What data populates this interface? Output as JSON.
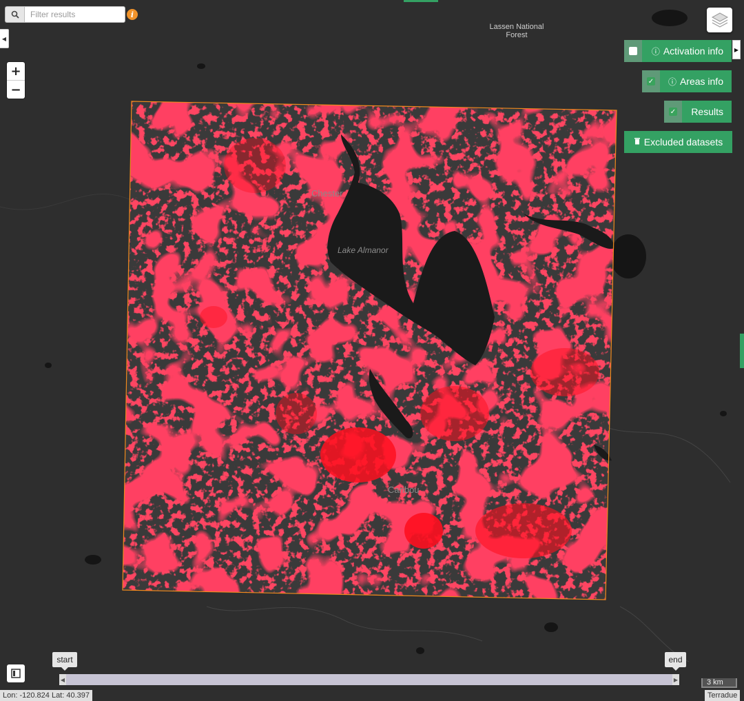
{
  "search": {
    "placeholder": "Filter results"
  },
  "zoom": {
    "in_label": "+",
    "out_label": "−"
  },
  "panel": {
    "activation_info": {
      "label": "Activation info",
      "checked": false
    },
    "areas_info": {
      "label": "Areas info",
      "checked": true
    },
    "results": {
      "label": "Results",
      "checked": true
    },
    "excluded_datasets": {
      "label": "Excluded datasets"
    }
  },
  "map_labels": {
    "forest": "Lassen National Forest",
    "chester": "Chester",
    "lake": "Lake Almanor",
    "caribou": "Caribou"
  },
  "timeline": {
    "start_label": "start",
    "end_label": "end"
  },
  "status": {
    "coords": "Lon: -120.824 Lat: 40.397",
    "scale": "3 km",
    "attribution": "Terradue"
  },
  "colors": {
    "result_overlay": "#ff1020",
    "aoi_outline": "#f08a1c",
    "panel_green": "#34a163",
    "basemap": "#2e2e2e"
  },
  "icons": {
    "search": "search-icon",
    "info": "info-icon",
    "layers": "layers-icon",
    "trash": "trash-icon",
    "legend": "legend-icon"
  }
}
